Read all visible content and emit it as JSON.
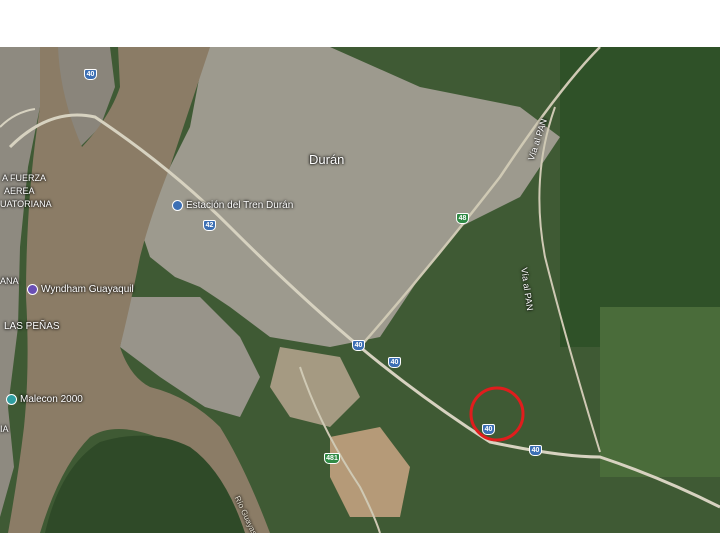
{
  "map": {
    "city_label": "Durán",
    "neighborhood_label": "LAS PEÑAS",
    "airforce_lines": [
      "A FUERZA",
      "AEREA",
      "UATORIANA"
    ],
    "edge_label_left": "ANA",
    "edge_label_bottom_left": "IA",
    "poi_train_station": "Estación del Tren Durán",
    "poi_hotel": "Wyndham Guayaquil",
    "poi_malecon": "Malecon 2000",
    "road_label_1": "Vía al PAN",
    "road_label_2": "Vía al PAN",
    "river_label": "Río Guayas",
    "route_shields": [
      {
        "id": "40",
        "color": "blue"
      },
      {
        "id": "40",
        "color": "blue"
      },
      {
        "id": "40",
        "color": "blue"
      },
      {
        "id": "40",
        "color": "blue"
      },
      {
        "id": "40",
        "color": "blue"
      },
      {
        "id": "42",
        "color": "blue"
      },
      {
        "id": "48",
        "color": "green"
      },
      {
        "id": "481",
        "color": "green"
      }
    ],
    "highlight_marker": {
      "shape": "circle",
      "color": "#e01d1d"
    },
    "colors": {
      "vegetation": "#3f5a34",
      "river": "#8b7c66",
      "urban": "#9d9a8e",
      "highlight": "#e01d1d"
    }
  }
}
